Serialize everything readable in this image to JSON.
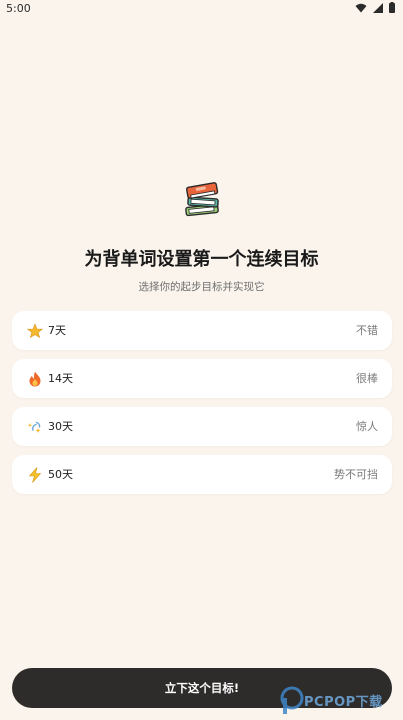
{
  "status_bar": {
    "time": "5:00",
    "icons": [
      "wifi-icon",
      "signal-icon",
      "battery-icon"
    ]
  },
  "hero": {
    "icon": "stacked-books-icon",
    "title": "为背单词设置第一个连续目标",
    "subtitle": "选择你的起步目标并实现它"
  },
  "goals": [
    {
      "icon": "star-icon",
      "days": "7天",
      "tag": "不错"
    },
    {
      "icon": "fire-icon",
      "days": "14天",
      "tag": "很棒"
    },
    {
      "icon": "sparkle-icon",
      "days": "30天",
      "tag": "惊人"
    },
    {
      "icon": "lightning-icon",
      "days": "50天",
      "tag": "势不可挡"
    }
  ],
  "cta": {
    "label": "立下这个目标!"
  },
  "watermark": {
    "text": "PCPOP下载"
  },
  "colors": {
    "background": "#FAF4EC",
    "card": "#FFFFFF",
    "cta": "#2E2B2B",
    "book_orange": "#E8643A",
    "book_teal": "#5BB7A6",
    "book_green": "#9BD07A"
  }
}
